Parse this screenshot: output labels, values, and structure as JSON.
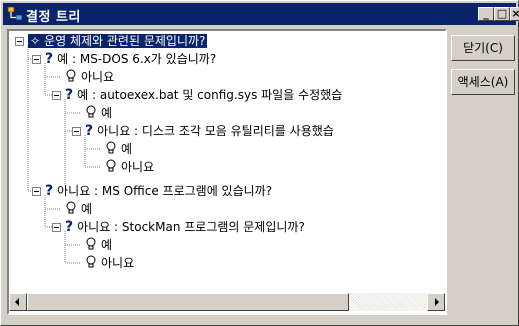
{
  "window": {
    "title": "결정 트리"
  },
  "titlebar_buttons": {
    "minimize": "_",
    "maximize": "□",
    "close": "×"
  },
  "buttons": {
    "close_label": "닫기(C)",
    "access_label": "액세스(A)"
  },
  "tree": {
    "root": "운영 체제와 관련된 문제입니까?",
    "nodes": [
      "예 : MS-DOS 6.x가 있습니까?",
      "아니요",
      "예 : autoexex.bat 및 config.sys 파일을 수정했습",
      "예",
      "아니요 : 디스크 조각 모음 유틸리티를 사용했습",
      "예",
      "아니요",
      "아니요 : MS Office 프로그램에 있습니까?",
      "예",
      "아니요 : StockMan 프로그램의 문제입니까?",
      "예",
      "아니요"
    ]
  },
  "icons": {
    "app": "decision-tree-icon",
    "question": "question-mark-icon",
    "answer": "lightbulb-icon"
  },
  "colors": {
    "titlebar": "#0a246a",
    "selection": "#0a246a",
    "face": "#d4d0c8"
  }
}
